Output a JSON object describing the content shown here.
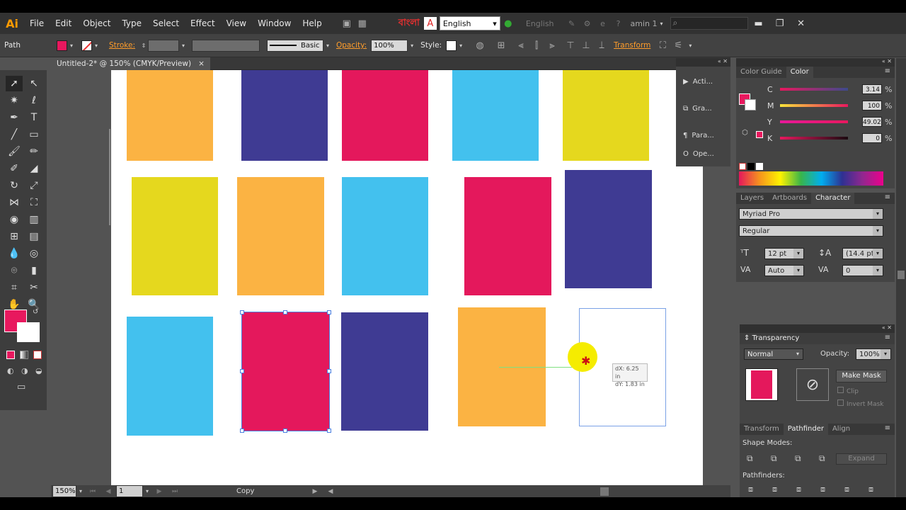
{
  "app": {
    "logo": "Ai",
    "bangla_text": "বাংলা",
    "window_title_user": "amin 1"
  },
  "menu": [
    "File",
    "Edit",
    "Object",
    "Type",
    "Select",
    "Effect",
    "View",
    "Window",
    "Help"
  ],
  "language": {
    "selected": "English",
    "ghost": "English"
  },
  "control_bar": {
    "selection_label": "Path",
    "stroke_label": "Stroke:",
    "brush_label": "Basic",
    "opacity_label": "Opacity:",
    "opacity_value": "100%",
    "style_label": "Style:",
    "transform_label": "Transform",
    "fill_color": "#e8185e"
  },
  "document_tab": {
    "title": "Untitled-2* @ 150% (CMYK/Preview)",
    "close": "×"
  },
  "actions_panel": {
    "items": [
      "Acti...",
      "Gra...",
      "Para...",
      "Ope..."
    ]
  },
  "color_panel": {
    "tabs": [
      "Color Guide",
      "Color"
    ],
    "channels": [
      {
        "name": "C",
        "value": "3.14",
        "unit": "%"
      },
      {
        "name": "M",
        "value": "100",
        "unit": "%"
      },
      {
        "name": "Y",
        "value": "49.02",
        "unit": "%"
      },
      {
        "name": "K",
        "value": "0",
        "unit": "%"
      }
    ]
  },
  "character_panel": {
    "tabs": [
      "Layers",
      "Artboards",
      "Character"
    ],
    "font_family": "Myriad Pro",
    "font_style": "Regular",
    "size": "12 pt",
    "leading": "(14.4 pt)",
    "kerning": "Auto",
    "tracking": "0"
  },
  "transparency_panel": {
    "title": "Transparency",
    "blend_mode": "Normal",
    "opacity_label": "Opacity:",
    "opacity_value": "100%",
    "make_mask": "Make Mask",
    "clip": "Clip",
    "invert_mask": "Invert Mask"
  },
  "pathfinder_panel": {
    "tabs": [
      "Transform",
      "Pathfinder",
      "Align"
    ],
    "shape_modes": "Shape Modes:",
    "pathfinders": "Pathfinders:",
    "expand": "Expand"
  },
  "drag_tooltip": {
    "dx": "dX: 6.25 in",
    "dy": "dY: 1.83 in"
  },
  "status_bar": {
    "zoom": "150%",
    "artboard": "1",
    "action": "Copy"
  },
  "colors": {
    "orange": "#fbb343",
    "navy": "#3f3b93",
    "magenta": "#e4185c",
    "cyan": "#43c1ee",
    "yellow": "#e5d81e"
  }
}
